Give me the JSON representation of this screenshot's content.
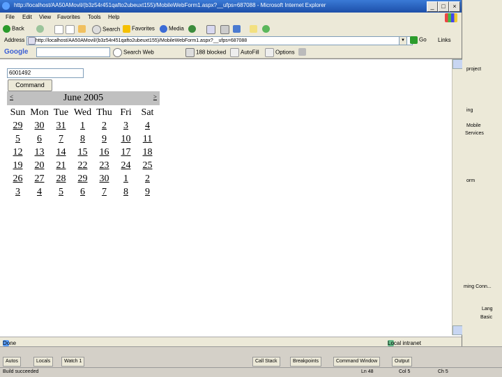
{
  "window": {
    "title": "http://localhost/AA50AMovil/(b3z54r451qafto2ubeuxt155)/MobileWebForm1.aspx?__ufps=687088 - Microsoft Internet Explorer",
    "buttons": [
      "_",
      "□",
      "×"
    ]
  },
  "menu": [
    "File",
    "Edit",
    "View",
    "Favorites",
    "Tools",
    "Help"
  ],
  "toolbar": {
    "back": "Back",
    "search": "Search",
    "favorites": "Favorites",
    "media": "Media"
  },
  "address": {
    "label": "Address",
    "url": "http://localhost/AA50AMovil/(b3z54r451qafto2ubeuxt155)/MobileWebForm1.aspx?__ufps=687088",
    "go": "Go",
    "links": "Links"
  },
  "google": {
    "brand": "Google",
    "search_web": "Search Web",
    "blocked": "188 blocked",
    "autofill": "AutoFill",
    "options": "Options"
  },
  "page": {
    "input_value": "6001492",
    "command_button": "Command",
    "calendar": {
      "month": "June 2005",
      "prev": "<",
      "next": ">",
      "days": [
        "Sun",
        "Mon",
        "Tue",
        "Wed",
        "Thu",
        "Fri",
        "Sat"
      ],
      "weeks": [
        [
          "29",
          "30",
          "31",
          "1",
          "2",
          "3",
          "4"
        ],
        [
          "5",
          "6",
          "7",
          "8",
          "9",
          "10",
          "11"
        ],
        [
          "12",
          "13",
          "14",
          "15",
          "16",
          "17",
          "18"
        ],
        [
          "19",
          "20",
          "21",
          "22",
          "23",
          "24",
          "25"
        ],
        [
          "26",
          "27",
          "28",
          "29",
          "30",
          "1",
          "2"
        ],
        [
          "3",
          "4",
          "5",
          "6",
          "7",
          "8",
          "9"
        ]
      ]
    }
  },
  "statusbar": {
    "left": "Done",
    "zone": "Local intranet"
  },
  "right_panel": {
    "items": [
      "project",
      "ing",
      "Mobile",
      "Services",
      "orm",
      "ming Conn...",
      "Lang",
      "Basic"
    ]
  },
  "bottom_tabs": {
    "left": [
      "Autos",
      "Locals",
      "Watch 1"
    ],
    "right": [
      "Call Stack",
      "Breakpoints",
      "Command Window",
      "Output"
    ]
  },
  "vs_status": {
    "ready": "Build succeeded",
    "ln": "Ln 48",
    "col": "Col 5",
    "ch": "Ch 5"
  }
}
